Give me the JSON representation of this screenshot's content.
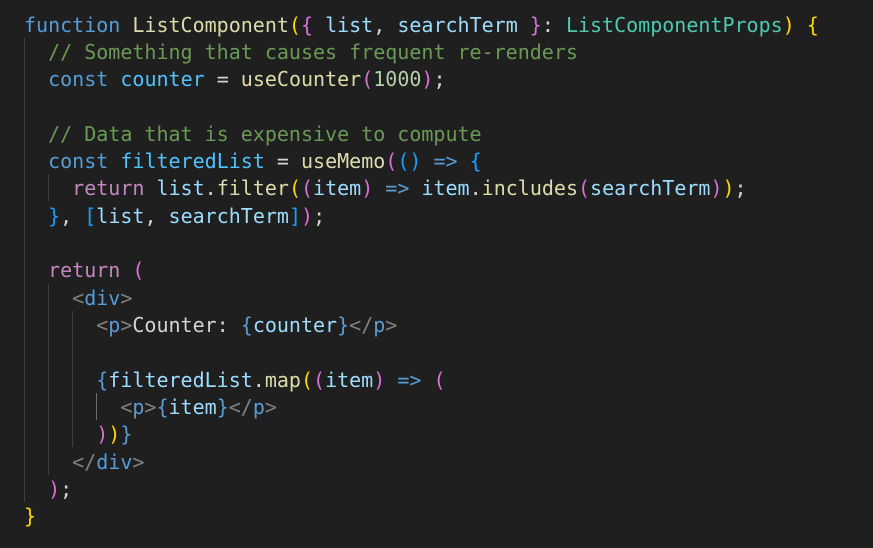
{
  "editor": {
    "language": "tsx",
    "lines": [
      [
        [
          "kw",
          "function"
        ],
        [
          "pun",
          " "
        ],
        [
          "fn",
          "ListComponent"
        ],
        [
          "b1",
          "("
        ],
        [
          "b2",
          "{"
        ],
        [
          "pun",
          " "
        ],
        [
          "var",
          "list"
        ],
        [
          "pun",
          ", "
        ],
        [
          "var",
          "searchTerm"
        ],
        [
          "pun",
          " "
        ],
        [
          "b2",
          "}"
        ],
        [
          "pun",
          ": "
        ],
        [
          "type",
          "ListComponentProps"
        ],
        [
          "b1",
          ")"
        ],
        [
          "pun",
          " "
        ],
        [
          "b1",
          "{"
        ]
      ],
      [
        [
          "pun",
          "  "
        ],
        [
          "com",
          "// Something that causes frequent re-renders"
        ]
      ],
      [
        [
          "pun",
          "  "
        ],
        [
          "kw",
          "const"
        ],
        [
          "pun",
          " "
        ],
        [
          "const",
          "counter"
        ],
        [
          "pun",
          " = "
        ],
        [
          "fn",
          "useCounter"
        ],
        [
          "b2",
          "("
        ],
        [
          "num",
          "1000"
        ],
        [
          "b2",
          ")"
        ],
        [
          "pun",
          ";"
        ]
      ],
      [],
      [
        [
          "pun",
          "  "
        ],
        [
          "com",
          "// Data that is expensive to compute"
        ]
      ],
      [
        [
          "pun",
          "  "
        ],
        [
          "kw",
          "const"
        ],
        [
          "pun",
          " "
        ],
        [
          "const",
          "filteredList"
        ],
        [
          "pun",
          " = "
        ],
        [
          "fn",
          "useMemo"
        ],
        [
          "b2",
          "("
        ],
        [
          "b3",
          "()"
        ],
        [
          "pun",
          " "
        ],
        [
          "kw",
          "=>"
        ],
        [
          "pun",
          " "
        ],
        [
          "b3",
          "{"
        ]
      ],
      [
        [
          "pun",
          "    "
        ],
        [
          "ctl",
          "return"
        ],
        [
          "pun",
          " "
        ],
        [
          "var",
          "list"
        ],
        [
          "pun",
          "."
        ],
        [
          "fn",
          "filter"
        ],
        [
          "b1",
          "("
        ],
        [
          "b2",
          "("
        ],
        [
          "var",
          "item"
        ],
        [
          "b2",
          ")"
        ],
        [
          "pun",
          " "
        ],
        [
          "kw",
          "=>"
        ],
        [
          "pun",
          " "
        ],
        [
          "var",
          "item"
        ],
        [
          "pun",
          "."
        ],
        [
          "fn",
          "includes"
        ],
        [
          "b2",
          "("
        ],
        [
          "var",
          "searchTerm"
        ],
        [
          "b2",
          ")"
        ],
        [
          "b1",
          ")"
        ],
        [
          "pun",
          ";"
        ]
      ],
      [
        [
          "pun",
          "  "
        ],
        [
          "b3",
          "}"
        ],
        [
          "pun",
          ", "
        ],
        [
          "b3",
          "["
        ],
        [
          "var",
          "list"
        ],
        [
          "pun",
          ", "
        ],
        [
          "var",
          "searchTerm"
        ],
        [
          "b3",
          "]"
        ],
        [
          "b2",
          ")"
        ],
        [
          "pun",
          ";"
        ]
      ],
      [],
      [
        [
          "pun",
          "  "
        ],
        [
          "ctl",
          "return"
        ],
        [
          "pun",
          " "
        ],
        [
          "b2",
          "("
        ]
      ],
      [
        [
          "pun",
          "    "
        ],
        [
          "angle",
          "<"
        ],
        [
          "tag",
          "div"
        ],
        [
          "angle",
          ">"
        ]
      ],
      [
        [
          "pun",
          "      "
        ],
        [
          "angle",
          "<"
        ],
        [
          "tag",
          "p"
        ],
        [
          "angle",
          ">"
        ],
        [
          "text",
          "Counter: "
        ],
        [
          "kw",
          "{"
        ],
        [
          "var",
          "counter"
        ],
        [
          "kw",
          "}"
        ],
        [
          "angle",
          "</"
        ],
        [
          "tag",
          "p"
        ],
        [
          "angle",
          ">"
        ]
      ],
      [],
      [
        [
          "pun",
          "      "
        ],
        [
          "kw",
          "{"
        ],
        [
          "var",
          "filteredList"
        ],
        [
          "pun",
          "."
        ],
        [
          "fn",
          "map"
        ],
        [
          "b1",
          "("
        ],
        [
          "b2",
          "("
        ],
        [
          "var",
          "item"
        ],
        [
          "b2",
          ")"
        ],
        [
          "pun",
          " "
        ],
        [
          "kw",
          "=>"
        ],
        [
          "pun",
          " "
        ],
        [
          "b2",
          "("
        ]
      ],
      [
        [
          "pun",
          "        "
        ],
        [
          "angle",
          "<"
        ],
        [
          "tag",
          "p"
        ],
        [
          "angle",
          ">"
        ],
        [
          "kw",
          "{"
        ],
        [
          "var",
          "item"
        ],
        [
          "kw",
          "}"
        ],
        [
          "angle",
          "</"
        ],
        [
          "tag",
          "p"
        ],
        [
          "angle",
          ">"
        ]
      ],
      [
        [
          "pun",
          "      "
        ],
        [
          "b2",
          ")"
        ],
        [
          "b1",
          ")"
        ],
        [
          "kw",
          "}"
        ]
      ],
      [
        [
          "pun",
          "    "
        ],
        [
          "angle",
          "</"
        ],
        [
          "tag",
          "div"
        ],
        [
          "angle",
          ">"
        ]
      ],
      [
        [
          "pun",
          "  "
        ],
        [
          "b2",
          ")"
        ],
        [
          "pun",
          ";"
        ]
      ],
      [
        [
          "b1",
          "}"
        ]
      ]
    ]
  }
}
